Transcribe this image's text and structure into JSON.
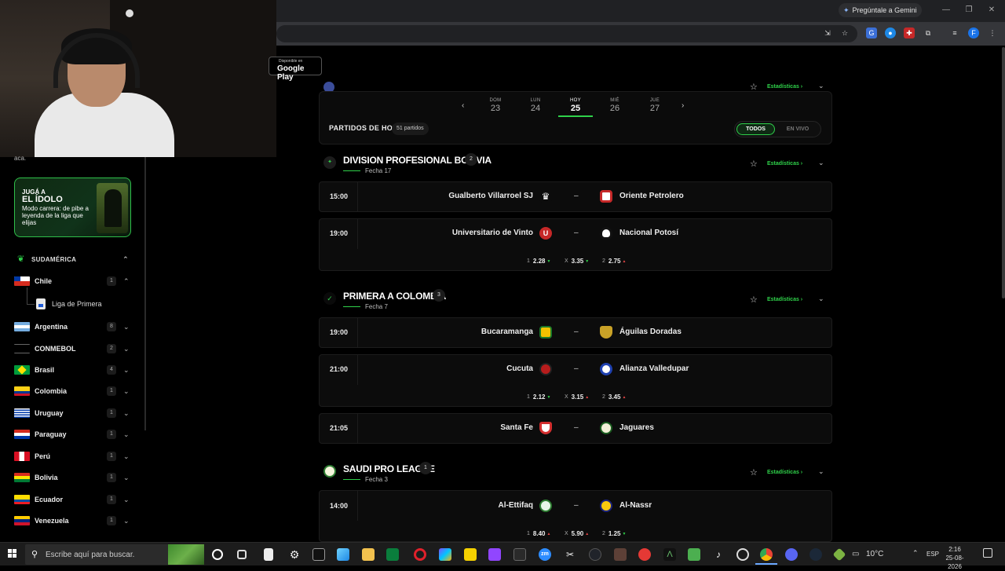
{
  "browser": {
    "gemini_label": "Pregúntale a Gemini",
    "profile_initial": "F"
  },
  "google_play": {
    "small": "Disponible en",
    "big": "Google Play"
  },
  "sidebar": {
    "top_text": "aca.",
    "promo": {
      "pre": "JUGÁ A",
      "title": "EL ÍDOLO",
      "body": "Modo carrera: de pibe a leyenda de la liga que elijas"
    },
    "region": "SUDAMÉRICA",
    "countries": [
      {
        "name": "Chile",
        "count": "1",
        "expanded": true
      },
      {
        "name": "Argentina",
        "count": "8"
      },
      {
        "name": "CONMEBOL",
        "count": "2"
      },
      {
        "name": "Brasil",
        "count": "4"
      },
      {
        "name": "Colombia",
        "count": "1"
      },
      {
        "name": "Uruguay",
        "count": "1"
      },
      {
        "name": "Paraguay",
        "count": "1"
      },
      {
        "name": "Perú",
        "count": "1"
      },
      {
        "name": "Bolivia",
        "count": "1"
      },
      {
        "name": "Ecuador",
        "count": "1"
      },
      {
        "name": "Venezuela",
        "count": "1"
      }
    ],
    "sub_league": "Liga de Primera"
  },
  "dates": {
    "days": [
      {
        "name": "DOM",
        "num": "23"
      },
      {
        "name": "LUN",
        "num": "24"
      },
      {
        "name": "HOY",
        "num": "25"
      },
      {
        "name": "MIÉ",
        "num": "26"
      },
      {
        "name": "JUE",
        "num": "27"
      }
    ],
    "today_title": "PARTIDOS DE HOY",
    "today_count": "51 partidos",
    "filter_all": "TODOS",
    "filter_live": "EN VIVO"
  },
  "leagues": [
    {
      "title": "DIVISION PROFESIONAL BOLIVIA",
      "count": "2",
      "round": "Fecha 17",
      "stats_label": "Estadísticas ›",
      "matches": [
        {
          "time": "15:00",
          "home": "Gualberto Villarroel SJ",
          "away": "Oriente Petrolero",
          "sep": "–"
        },
        {
          "time": "19:00",
          "home": "Universitario de Vinto",
          "away": "Nacional Potosí",
          "sep": "–",
          "odds": [
            {
              "label": "1",
              "value": "2.28",
              "trend": "up"
            },
            {
              "label": "X",
              "value": "3.35",
              "trend": "up"
            },
            {
              "label": "2",
              "value": "2.75",
              "trend": "down"
            }
          ]
        }
      ]
    },
    {
      "title": "PRIMERA A COLOMBIA",
      "count": "3",
      "round": "Fecha 7",
      "stats_label": "Estadísticas ›",
      "matches": [
        {
          "time": "19:00",
          "home": "Bucaramanga",
          "away": "Águilas Doradas",
          "sep": "–"
        },
        {
          "time": "21:00",
          "home": "Cucuta",
          "away": "Alianza Valledupar",
          "sep": "–",
          "odds": [
            {
              "label": "1",
              "value": "2.12",
              "trend": "up"
            },
            {
              "label": "X",
              "value": "3.15",
              "trend": "down"
            },
            {
              "label": "2",
              "value": "3.45",
              "trend": "down"
            }
          ]
        },
        {
          "time": "21:05",
          "home": "Santa Fe",
          "away": "Jaguares",
          "sep": "–"
        }
      ]
    },
    {
      "title": "SAUDI PRO LEAGUE",
      "count": "1",
      "round": "Fecha 3",
      "stats_label": "Estadísticas ›",
      "matches": [
        {
          "time": "14:00",
          "home": "Al-Ettifaq",
          "away": "Al-Nassr",
          "sep": "–",
          "odds": [
            {
              "label": "1",
              "value": "8.40",
              "trend": "down"
            },
            {
              "label": "X",
              "value": "5.90",
              "trend": "down"
            },
            {
              "label": "2",
              "value": "1.25",
              "trend": "up"
            }
          ]
        }
      ]
    }
  ],
  "prev_league_stats": "Estadísticas ›",
  "taskbar": {
    "search_placeholder": "Escribe aquí para buscar.",
    "weather": "10°C",
    "lang": "ESP",
    "time": "2:16",
    "date": "25-08-2026"
  }
}
